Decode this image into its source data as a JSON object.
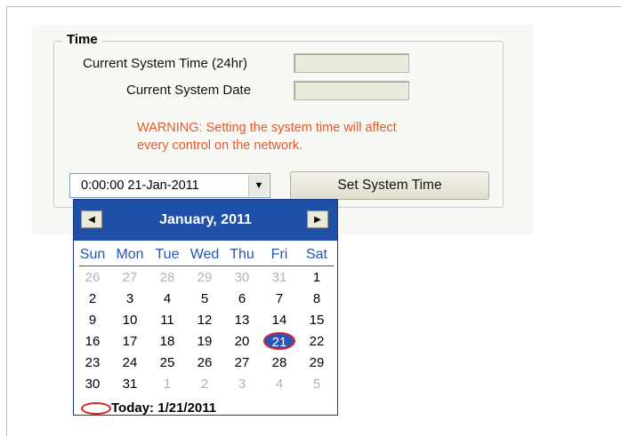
{
  "group": {
    "legend": "Time"
  },
  "fields": {
    "time_label": "Current System Time (24hr)",
    "time_value": "",
    "date_label": "Current System Date",
    "date_value": ""
  },
  "warning": {
    "line1": "WARNING: Setting the system time will affect",
    "line2": "every control on the network."
  },
  "picker": {
    "value": "0:00:00 21-Jan-2011",
    "dropdown_icon": "triangle-down"
  },
  "set_button": {
    "label": "Set System Time"
  },
  "calendar": {
    "title": "January, 2011",
    "prev_icon": "triangle-left",
    "next_icon": "triangle-right",
    "weekdays": [
      "Sun",
      "Mon",
      "Tue",
      "Wed",
      "Thu",
      "Fri",
      "Sat"
    ],
    "weeks": [
      [
        {
          "d": "26",
          "m": true
        },
        {
          "d": "27",
          "m": true
        },
        {
          "d": "28",
          "m": true
        },
        {
          "d": "29",
          "m": true
        },
        {
          "d": "30",
          "m": true
        },
        {
          "d": "31",
          "m": true
        },
        {
          "d": "1"
        }
      ],
      [
        {
          "d": "2"
        },
        {
          "d": "3"
        },
        {
          "d": "4"
        },
        {
          "d": "5"
        },
        {
          "d": "6"
        },
        {
          "d": "7"
        },
        {
          "d": "8"
        }
      ],
      [
        {
          "d": "9"
        },
        {
          "d": "10"
        },
        {
          "d": "11"
        },
        {
          "d": "12"
        },
        {
          "d": "13"
        },
        {
          "d": "14"
        },
        {
          "d": "15"
        }
      ],
      [
        {
          "d": "16"
        },
        {
          "d": "17"
        },
        {
          "d": "18"
        },
        {
          "d": "19"
        },
        {
          "d": "20"
        },
        {
          "d": "21",
          "sel": true
        },
        {
          "d": "22"
        }
      ],
      [
        {
          "d": "23"
        },
        {
          "d": "24"
        },
        {
          "d": "25"
        },
        {
          "d": "26"
        },
        {
          "d": "27"
        },
        {
          "d": "28"
        },
        {
          "d": "29"
        }
      ],
      [
        {
          "d": "30"
        },
        {
          "d": "31"
        },
        {
          "d": "1",
          "m": true
        },
        {
          "d": "2",
          "m": true
        },
        {
          "d": "3",
          "m": true
        },
        {
          "d": "4",
          "m": true
        },
        {
          "d": "5",
          "m": true
        }
      ]
    ],
    "today_label": "Today: 1/21/2011"
  },
  "colors": {
    "header": "#1f50a8",
    "weekday": "#2355b5",
    "warning": "#e25a2c",
    "highlight": "#d8232a"
  }
}
